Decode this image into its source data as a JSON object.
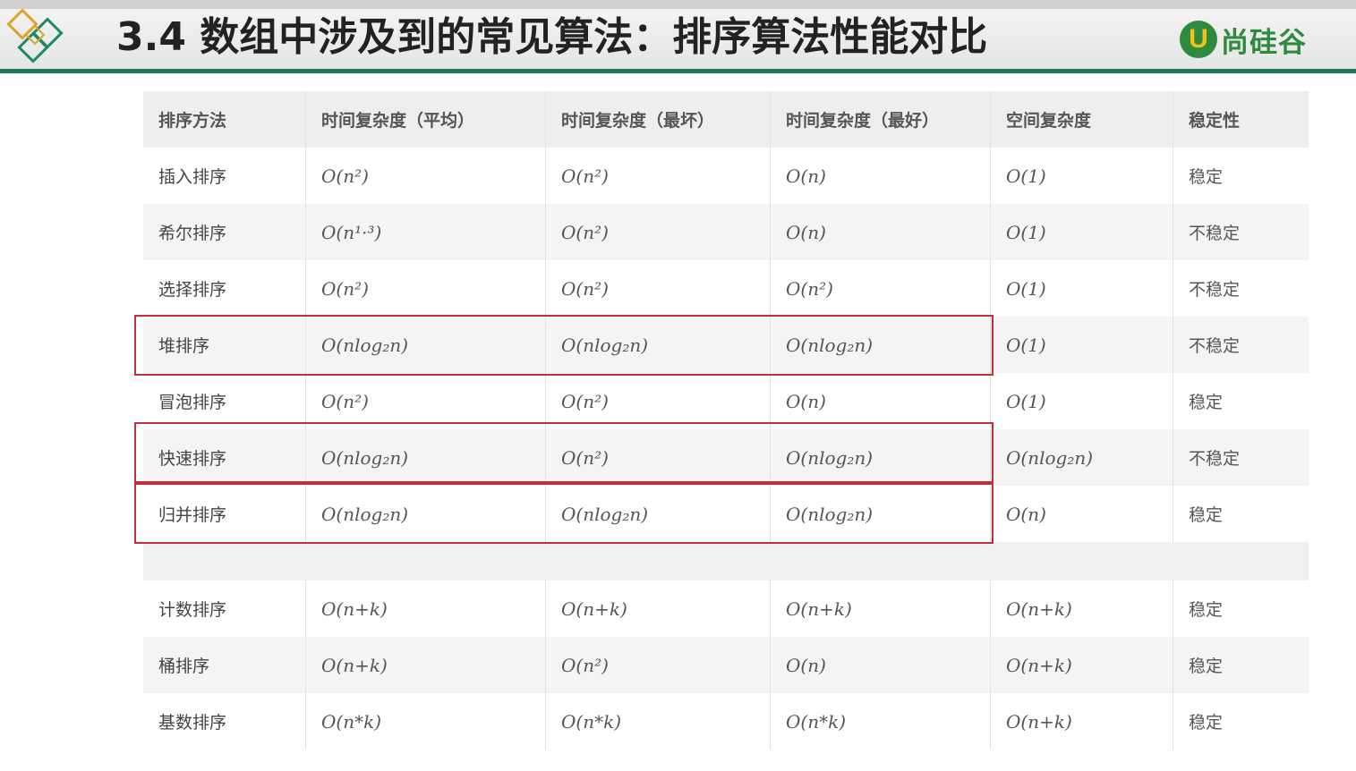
{
  "header": {
    "title": "3.4 数组中涉及到的常见算法：排序算法性能对比",
    "brand_mark": "U",
    "brand_text": "尚硅谷"
  },
  "colors": {
    "header_rule": "#1f7a5a",
    "highlight_border": "#c0303a",
    "brand_green": "#2e8a3c",
    "brand_yellow": "#f3c21b"
  },
  "table": {
    "columns": [
      "排序方法",
      "时间复杂度（平均）",
      "时间复杂度（最坏）",
      "时间复杂度（最好）",
      "空间复杂度",
      "稳定性"
    ],
    "rows": [
      {
        "name": "插入排序",
        "avg": "O(n²)",
        "worst": "O(n²)",
        "best": "O(n)",
        "space": "O(1)",
        "stability": "稳定"
      },
      {
        "name": "希尔排序",
        "avg": "O(n¹·³)",
        "worst": "O(n²)",
        "best": "O(n)",
        "space": "O(1)",
        "stability": "不稳定"
      },
      {
        "name": "选择排序",
        "avg": "O(n²)",
        "worst": "O(n²)",
        "best": "O(n²)",
        "space": "O(1)",
        "stability": "不稳定"
      },
      {
        "name": "堆排序",
        "avg": "O(nlog₂n)",
        "worst": "O(nlog₂n)",
        "best": "O(nlog₂n)",
        "space": "O(1)",
        "stability": "不稳定"
      },
      {
        "name": "冒泡排序",
        "avg": "O(n²)",
        "worst": "O(n²)",
        "best": "O(n)",
        "space": "O(1)",
        "stability": "稳定"
      },
      {
        "name": "快速排序",
        "avg": "O(nlog₂n)",
        "worst": "O(n²)",
        "best": "O(nlog₂n)",
        "space": "O(nlog₂n)",
        "stability": "不稳定"
      },
      {
        "name": "归并排序",
        "avg": "O(nlog₂n)",
        "worst": "O(nlog₂n)",
        "best": "O(nlog₂n)",
        "space": "O(n)",
        "stability": "稳定"
      },
      {
        "name": "计数排序",
        "avg": "O(n+k)",
        "worst": "O(n+k)",
        "best": "O(n+k)",
        "space": "O(n+k)",
        "stability": "稳定"
      },
      {
        "name": "桶排序",
        "avg": "O(n+k)",
        "worst": "O(n²)",
        "best": "O(n)",
        "space": "O(n+k)",
        "stability": "稳定"
      },
      {
        "name": "基数排序",
        "avg": "O(n*k)",
        "worst": "O(n*k)",
        "best": "O(n*k)",
        "space": "O(n+k)",
        "stability": "稳定"
      }
    ]
  }
}
